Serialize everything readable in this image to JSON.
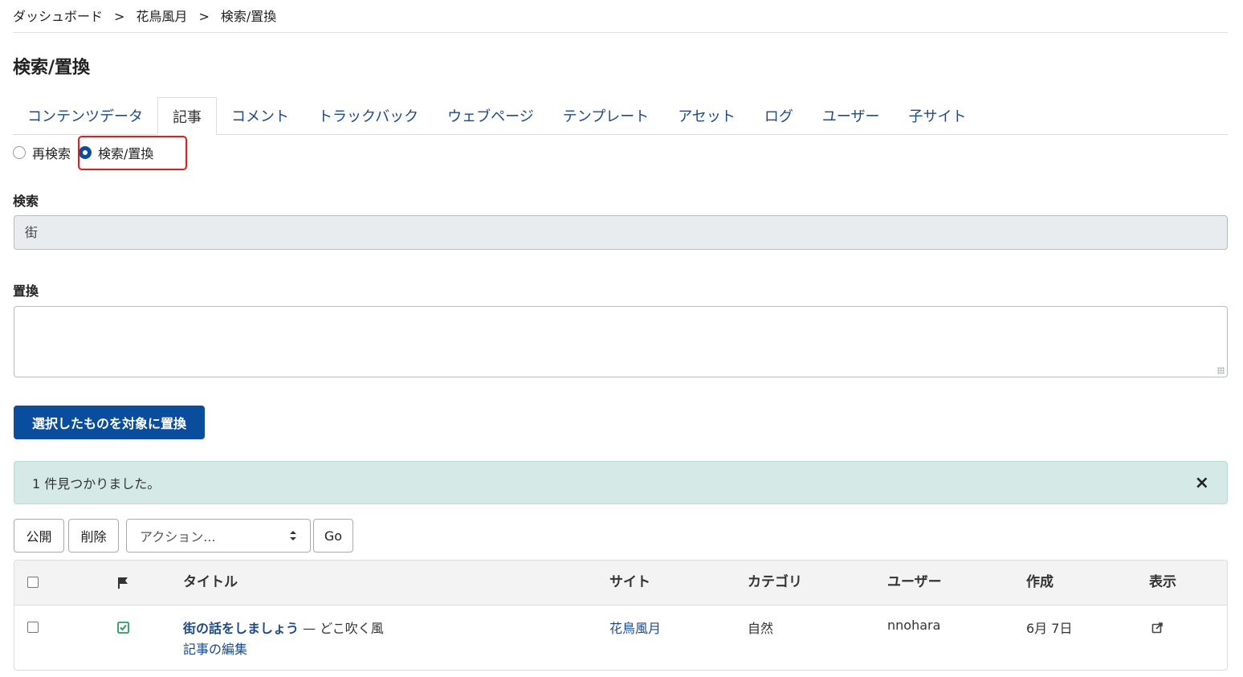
{
  "breadcrumb": {
    "item1": "ダッシュボード",
    "item2": "花鳥風月",
    "item3": "検索/置換",
    "sep": ">"
  },
  "page_title": "検索/置換",
  "tabs": [
    "コンテンツデータ",
    "記事",
    "コメント",
    "トラックバック",
    "ウェブページ",
    "テンプレート",
    "アセット",
    "ログ",
    "ユーザー",
    "子サイト"
  ],
  "active_tab": "記事",
  "radio": {
    "option1": "再検索",
    "option2": "検索/置換",
    "selected": "検索/置換"
  },
  "search": {
    "label": "検索",
    "value": "街"
  },
  "replace": {
    "label": "置換",
    "value": ""
  },
  "replace_button": "選択したものを対象に置換",
  "alert": {
    "message": "1 件見つかりました。",
    "close": "×"
  },
  "actions": {
    "publish": "公開",
    "delete": "削除",
    "select": "アクション...",
    "go": "Go"
  },
  "table": {
    "headers": {
      "title": "タイトル",
      "site": "サイト",
      "category": "カテゴリ",
      "user": "ユーザー",
      "created": "作成",
      "view": "表示"
    },
    "rows": [
      {
        "title": "街の話をしましょう",
        "excerpt": "— どこ吹く風",
        "edit": "記事の編集",
        "site": "花鳥風月",
        "category": "自然",
        "user": "nnohara",
        "created": "6月 7日",
        "status": "published"
      }
    ]
  },
  "colors": {
    "primary": "#0a4d9c",
    "link": "#1c4a8a",
    "alert_bg": "#d5e9e6",
    "highlight": "#e51c1c",
    "status_ok": "#2e9a5c"
  }
}
